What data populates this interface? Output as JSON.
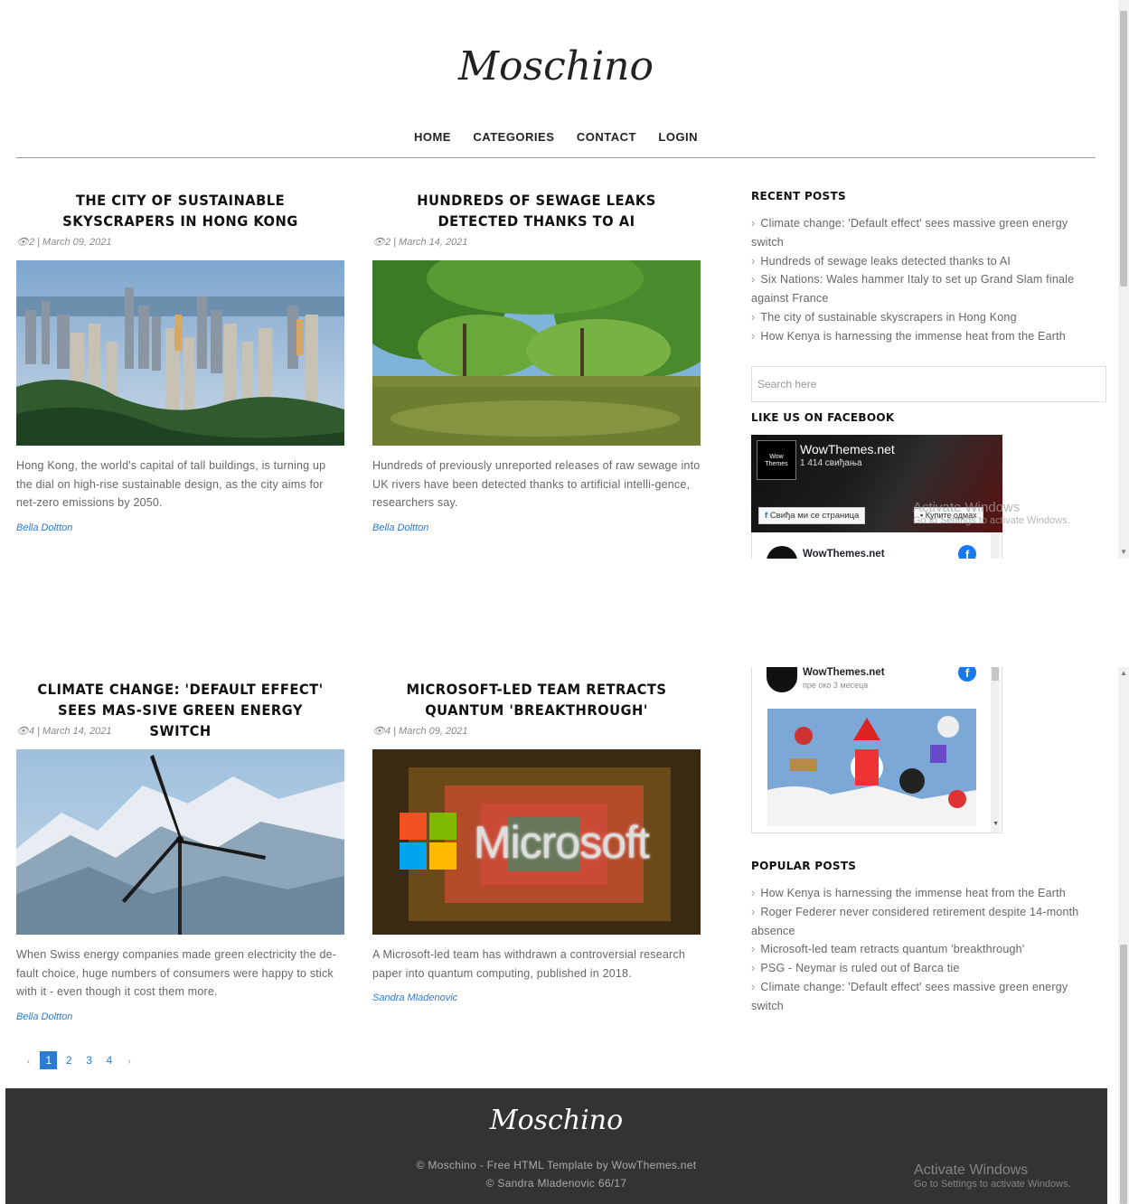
{
  "site": {
    "logo": "Moschino"
  },
  "nav": {
    "home": "HOME",
    "categories": "CATEGORIES",
    "contact": "CONTACT",
    "login": "LOGIN"
  },
  "posts": [
    {
      "title": "THE CITY OF SUSTAINABLE SKYSCRAPERS IN HONG KONG",
      "meta": "👁2 | March 09, 2021",
      "excerpt": "Hong Kong, the world's capital of tall buildings, is turning up the dial on high-rise sustainable design, as the city aims for net-zero emissions by 2050.",
      "author": "Bella Doltton"
    },
    {
      "title": "HUNDREDS OF SEWAGE LEAKS DETECTED THANKS TO AI",
      "meta": "👁2 | March 14, 2021",
      "excerpt": "Hundreds of previously unreported releases of raw sewage into UK rivers have been detected thanks to artificial intelli-gence, researchers say.",
      "author": "Bella Doltton"
    },
    {
      "title": "CLIMATE CHANGE: 'DEFAULT EFFECT' SEES MAS-SIVE GREEN ENERGY SWITCH",
      "meta": "👁4 | March 14, 2021",
      "excerpt": "When Swiss energy companies made green electricity the de-fault choice, huge numbers of consumers were happy to stick with it - even though it cost them more.",
      "author": "Bella Doltton"
    },
    {
      "title": "MICROSOFT-LED TEAM RETRACTS QUANTUM 'BREAKTHROUGH'",
      "meta": "👁4 | March 09, 2021",
      "excerpt": "A Microsoft-led team has withdrawn a controversial research paper into quantum computing, published in 2018.",
      "author": "Sandra Mladenovic",
      "image_text": "Microsoft"
    }
  ],
  "sidebar": {
    "recent_title": "RECENT POSTS",
    "recent": [
      "Climate change: 'Default effect' sees massive green energy switch",
      "Hundreds of sewage leaks detected thanks to AI",
      "Six Nations: Wales hammer Italy to set up Grand Slam finale against France",
      "The city of sustainable skyscrapers in Hong Kong",
      "How Kenya is harnessing the immense heat from the Earth"
    ],
    "search_placeholder": "Search here",
    "facebook_title": "LIKE US ON FACEBOOK",
    "fb_name": "WowThemes.net",
    "fb_likes": "1 414 свиђања",
    "fb_avatar": "Wow Themes",
    "fb_like_btn": "Свиђа ми се страница",
    "fb_buy_btn": "Купите одмах",
    "fb_feed_name": "WowThemes.net",
    "fb_feed_time": "пре око 3 месеца",
    "popular_title": "POPULAR POSTS",
    "popular": [
      "How Kenya is harnessing the immense heat from the Earth",
      "Roger Federer never considered retirement despite 14-month absence",
      "Microsoft-led team retracts quantum 'breakthrough'",
      "PSG - Neymar is ruled out of Barca tie",
      "Climate change: 'Default effect' sees massive green energy switch"
    ]
  },
  "pagination": {
    "prev": "‹",
    "pages": [
      "1",
      "2",
      "3",
      "4"
    ],
    "next": "›",
    "active": "1"
  },
  "footer": {
    "logo": "Moschino",
    "line1": "© Moschino - Free HTML Template by WowThemes.net",
    "line2": "© Sandra Mladenovic 66/17"
  },
  "watermark": {
    "title": "Activate Windows",
    "sub": "Go to Settings to activate Windows."
  },
  "colors": {
    "accent": "#2a7bd1",
    "footer_bg": "#333333",
    "facebook": "#1877f2"
  }
}
